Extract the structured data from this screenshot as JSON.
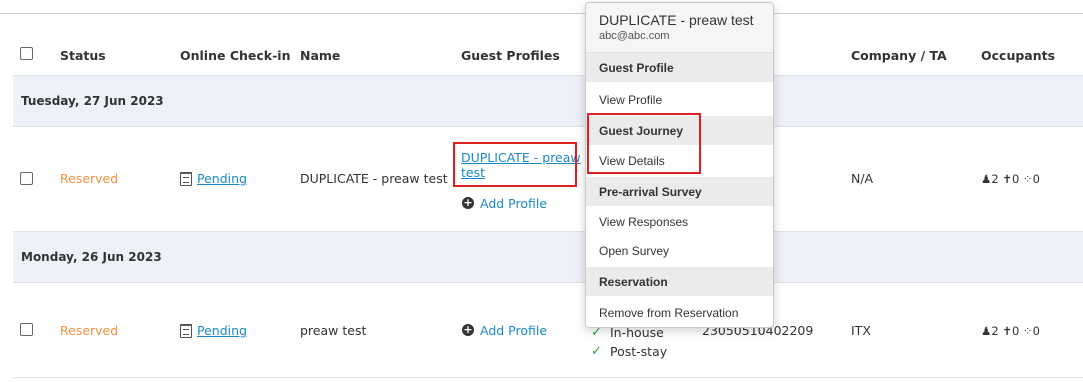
{
  "table": {
    "headers": {
      "status": "Status",
      "online_checkin": "Online Check-in",
      "name": "Name",
      "guest_profiles": "Guest Profiles",
      "company": "Company / TA",
      "occupants": "Occupants"
    },
    "groups": [
      {
        "date": "Tuesday, 27 Jun 2023",
        "row": {
          "status": "Reserved",
          "checkin": "Pending",
          "name": "DUPLICATE - preaw test",
          "profile_link_line1": "DUPLICATE - preaw",
          "profile_link_line2": "test",
          "add_profile": "Add Profile",
          "company": "N/A",
          "adults": "2",
          "children": "0",
          "infants": "0"
        }
      },
      {
        "date": "Monday, 26 Jun 2023",
        "row": {
          "status": "Reserved",
          "checkin": "Pending",
          "name": "preaw test",
          "add_profile": "Add Profile",
          "stage_inhouse": "In-house",
          "stage_poststay": "Post-stay",
          "reservation_no": "23050510402209",
          "company": "ITX",
          "adults": "2",
          "children": "0",
          "infants": "0"
        }
      }
    ]
  },
  "popover": {
    "title": "DUPLICATE - preaw test",
    "email": "abc@abc.com",
    "sections": [
      {
        "heading": "Guest Profile",
        "items": [
          "View Profile"
        ]
      },
      {
        "heading": "Guest Journey",
        "items": [
          "View Details"
        ]
      },
      {
        "heading": "Pre-arrival Survey",
        "items": [
          "View Responses",
          "Open Survey"
        ]
      },
      {
        "heading": "Reservation",
        "items": [
          "Remove from Reservation"
        ]
      }
    ]
  },
  "colors": {
    "reserved": "#f0913a",
    "link": "#1a88c9",
    "highlight": "#e02020",
    "check": "#27a844"
  }
}
